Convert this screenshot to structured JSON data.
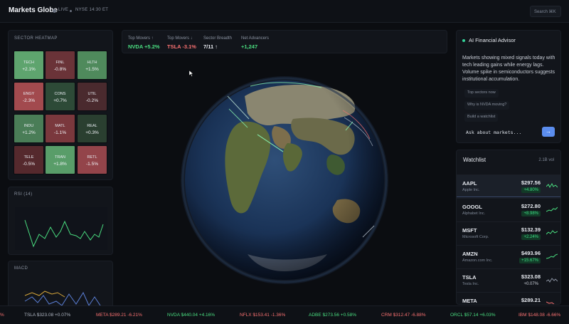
{
  "header": {
    "title": "Markets Globe",
    "live_label": "LIVE",
    "market_status": "NYSE 14:30 ET",
    "search_label": "Search ⌘K"
  },
  "heatmap": {
    "title": "SECTOR HEATMAP",
    "cells": [
      {
        "sym": "TECH",
        "chg": "+2.1%",
        "color": "#5ea46e"
      },
      {
        "sym": "FINL",
        "chg": "-0.8%",
        "color": "#6a3338"
      },
      {
        "sym": "HLTH",
        "chg": "+1.5%",
        "color": "#4f8a5c"
      },
      {
        "sym": "ENGY",
        "chg": "-2.3%",
        "color": "#a24a4e"
      },
      {
        "sym": "CONS",
        "chg": "+0.7%",
        "color": "#2d4a37"
      },
      {
        "sym": "UTIL",
        "chg": "-0.2%",
        "color": "#4a2a2e"
      },
      {
        "sym": "INDU",
        "chg": "+1.2%",
        "color": "#4a7d57"
      },
      {
        "sym": "MATL",
        "chg": "-1.1%",
        "color": "#7a383d"
      },
      {
        "sym": "REAL",
        "chg": "+0.3%",
        "color": "#2a3f30"
      },
      {
        "sym": "TELE",
        "chg": "-0.5%",
        "color": "#55292d"
      },
      {
        "sym": "TRAN",
        "chg": "+1.8%",
        "color": "#599d69"
      },
      {
        "sym": "RETL",
        "chg": "-1.5%",
        "color": "#93444a"
      }
    ]
  },
  "rsi": {
    "title": "RSI (14)"
  },
  "macd": {
    "title": "MACD"
  },
  "stats": [
    {
      "label": "Top Movers ↑",
      "value": "NVDA +5.2%",
      "color": "#4ade80"
    },
    {
      "label": "Top Movers ↓",
      "value": "TSLA -3.1%",
      "color": "#f87171"
    },
    {
      "label": "Sector Breadth",
      "value": "7/11 ↑",
      "color": "#e6e9ef"
    },
    {
      "label": "Net Advancers",
      "value": "+1,247",
      "color": "#4ade80"
    }
  ],
  "advisor": {
    "title": "AI Financial Advisor",
    "message": "Markets showing mixed signals today with tech leading gains while energy lags. Volume spike in semiconductors suggests institutional accumulation.",
    "chips": [
      "Top sectors now",
      "Why is NVDA moving?",
      "Build a watchlist"
    ],
    "input_placeholder": "Ask about markets...",
    "send_icon": "→"
  },
  "watchlist": {
    "title": "Watchlist",
    "volume": "2.1B vol",
    "rows": [
      {
        "sym": "AAPL",
        "name": "Apple Inc.",
        "price": "$297.56",
        "chg": "+4.80%",
        "dir": "up"
      },
      {
        "sym": "GOOGL",
        "name": "Alphabet Inc.",
        "price": "$272.80",
        "chg": "+8.98%",
        "dir": "up"
      },
      {
        "sym": "MSFT",
        "name": "Microsoft Corp.",
        "price": "$132.39",
        "chg": "+2.24%",
        "dir": "up"
      },
      {
        "sym": "AMZN",
        "name": "Amazon.com Inc.",
        "price": "$493.96",
        "chg": "+15.67%",
        "dir": "up"
      },
      {
        "sym": "TSLA",
        "name": "Tesla Inc.",
        "price": "$323.08",
        "chg": "+0.07%",
        "dir": "flat"
      },
      {
        "sym": "META",
        "name": "",
        "price": "$289.21",
        "chg": "",
        "dir": "down"
      }
    ]
  },
  "ticker": [
    {
      "text": "%",
      "dir": "down"
    },
    {
      "text": "TSLA $323.08 +0.07%",
      "dir": "neutral"
    },
    {
      "text": "META $289.21 -6.21%",
      "dir": "down"
    },
    {
      "text": "NVDA $440.04 +4.16%",
      "dir": "up"
    },
    {
      "text": "NFLX $153.41 -1.36%",
      "dir": "down"
    },
    {
      "text": "ADBE $273.56 +0.58%",
      "dir": "up"
    },
    {
      "text": "CRM $312.47 -6.88%",
      "dir": "down"
    },
    {
      "text": "ORCL $57.14 +6.03%",
      "dir": "up"
    },
    {
      "text": "IBM $148.08 -6.66%",
      "dir": "down"
    }
  ],
  "colors": {
    "up": "#4ade80",
    "down": "#f87171",
    "accent": "#5b8dee"
  }
}
